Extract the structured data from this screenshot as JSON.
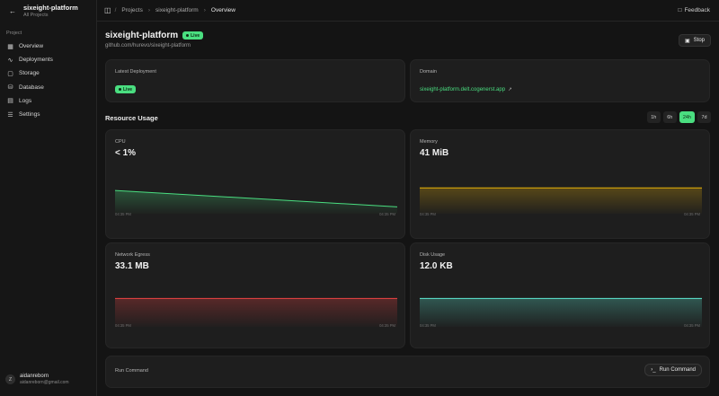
{
  "sidebar": {
    "project_name": "sixeight-platform",
    "project_sub": "All Projects",
    "section_label": "Project",
    "items": [
      {
        "label": "Overview",
        "icon": "layout-icon"
      },
      {
        "label": "Deployments",
        "icon": "activity-icon"
      },
      {
        "label": "Storage",
        "icon": "box-icon"
      },
      {
        "label": "Database",
        "icon": "database-icon"
      },
      {
        "label": "Logs",
        "icon": "file-text-icon"
      },
      {
        "label": "Settings",
        "icon": "sliders-icon"
      }
    ],
    "user": {
      "initial": "Z",
      "name": "aidanreborn",
      "email": "aidanreborn@gmail.com"
    }
  },
  "topbar": {
    "crumbs": [
      "Projects",
      "sixeight-platform",
      "Overview"
    ],
    "feedback_label": "Feedback"
  },
  "header": {
    "title": "sixeight-platform",
    "status": "Live",
    "repo": "github.com/hurevo/sixeight-platform",
    "stop_label": "Stop"
  },
  "deployment": {
    "label": "Latest Deployment",
    "status": "Live"
  },
  "domain": {
    "label": "Domain",
    "url": "sixeight-platform.delt.cogenerst.app"
  },
  "resource": {
    "title": "Resource Usage",
    "ranges": [
      "1h",
      "6h",
      "24h",
      "7d"
    ],
    "active_range": "24h"
  },
  "metrics": {
    "cpu": {
      "label": "CPU",
      "value": "< 1%",
      "t_start": "04:35 PM",
      "t_end": "04:35 PM"
    },
    "memory": {
      "label": "Memory",
      "value": "41 MiB",
      "t_start": "04:35 PM",
      "t_end": "04:35 PM"
    },
    "network": {
      "label": "Network Egress",
      "value": "33.1 MB",
      "t_start": "04:35 PM",
      "t_end": "04:35 PM"
    },
    "disk": {
      "label": "Disk Usage",
      "value": "12.0 KB",
      "t_start": "04:35 PM",
      "t_end": "04:35 PM"
    }
  },
  "chart_data": [
    {
      "type": "area",
      "series": [
        {
          "values": [
            0.54,
            0.16
          ]
        }
      ],
      "ylim": [
        0,
        1
      ],
      "color": "#4ade80"
    },
    {
      "type": "area",
      "series": [
        {
          "values": [
            0.6,
            0.6
          ]
        }
      ],
      "ylim": [
        0,
        1
      ],
      "color": "#eab308"
    },
    {
      "type": "area",
      "series": [
        {
          "values": [
            0.66,
            0.66
          ]
        }
      ],
      "ylim": [
        0,
        1
      ],
      "color": "#ef4444"
    },
    {
      "type": "area",
      "series": [
        {
          "values": [
            0.66,
            0.66
          ]
        }
      ],
      "ylim": [
        0,
        1
      ],
      "color": "#5eead4"
    }
  ],
  "run_command": {
    "label": "Run Command",
    "button_label": "Run Command"
  }
}
